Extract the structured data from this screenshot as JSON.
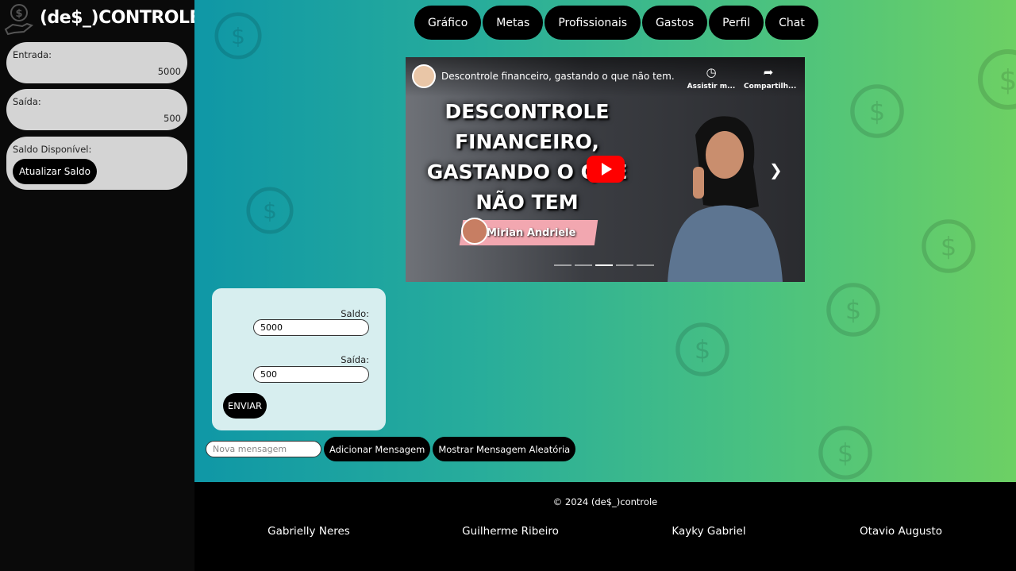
{
  "brand": {
    "title": "(de$_)CONTROLE"
  },
  "sidebar": {
    "entrada": {
      "label": "Entrada:",
      "value": "5000"
    },
    "saida": {
      "label": "Saída:",
      "value": "500"
    },
    "saldo": {
      "label": "Saldo Disponível:",
      "button": "Atualizar Saldo"
    }
  },
  "nav": {
    "items": [
      "Gráfico",
      "Metas",
      "Profissionais",
      "Gastos",
      "Perfil",
      "Chat"
    ]
  },
  "video": {
    "title": "Descontrole financeiro, gastando o que não tem.",
    "watch_later": "Assistir m...",
    "share": "Compartilh...",
    "thumbnail_headline": [
      "DESCONTROLE",
      "FINANCEIRO,",
      "GASTANDO O QUE",
      "NÃO TEM"
    ],
    "channel_badge": "Mirian Andriele"
  },
  "form": {
    "saldo_label": "Saldo:",
    "saldo_value": "5000",
    "saida_label": "Saída:",
    "saida_value": "500",
    "submit": "ENVIAR"
  },
  "messages": {
    "placeholder": "Nova mensagem",
    "add_button": "Adicionar Mensagem",
    "random_button": "Mostrar Mensagem Aleatória"
  },
  "footer": {
    "copyright": "© 2024 (de$_)controle",
    "authors": [
      "Gabrielly Neres",
      "Guilherme Ribeiro",
      "Kayky Gabriel",
      "Otavio Augusto"
    ]
  },
  "colors": {
    "gradient_start": "#0f97a6",
    "gradient_end": "#6dd064",
    "sidebar_bg": "#0a0a0a",
    "card_bg": "#d4d4d4",
    "form_bg": "#d7eeef",
    "button_bg": "#000000",
    "play_button": "#ff0000"
  }
}
